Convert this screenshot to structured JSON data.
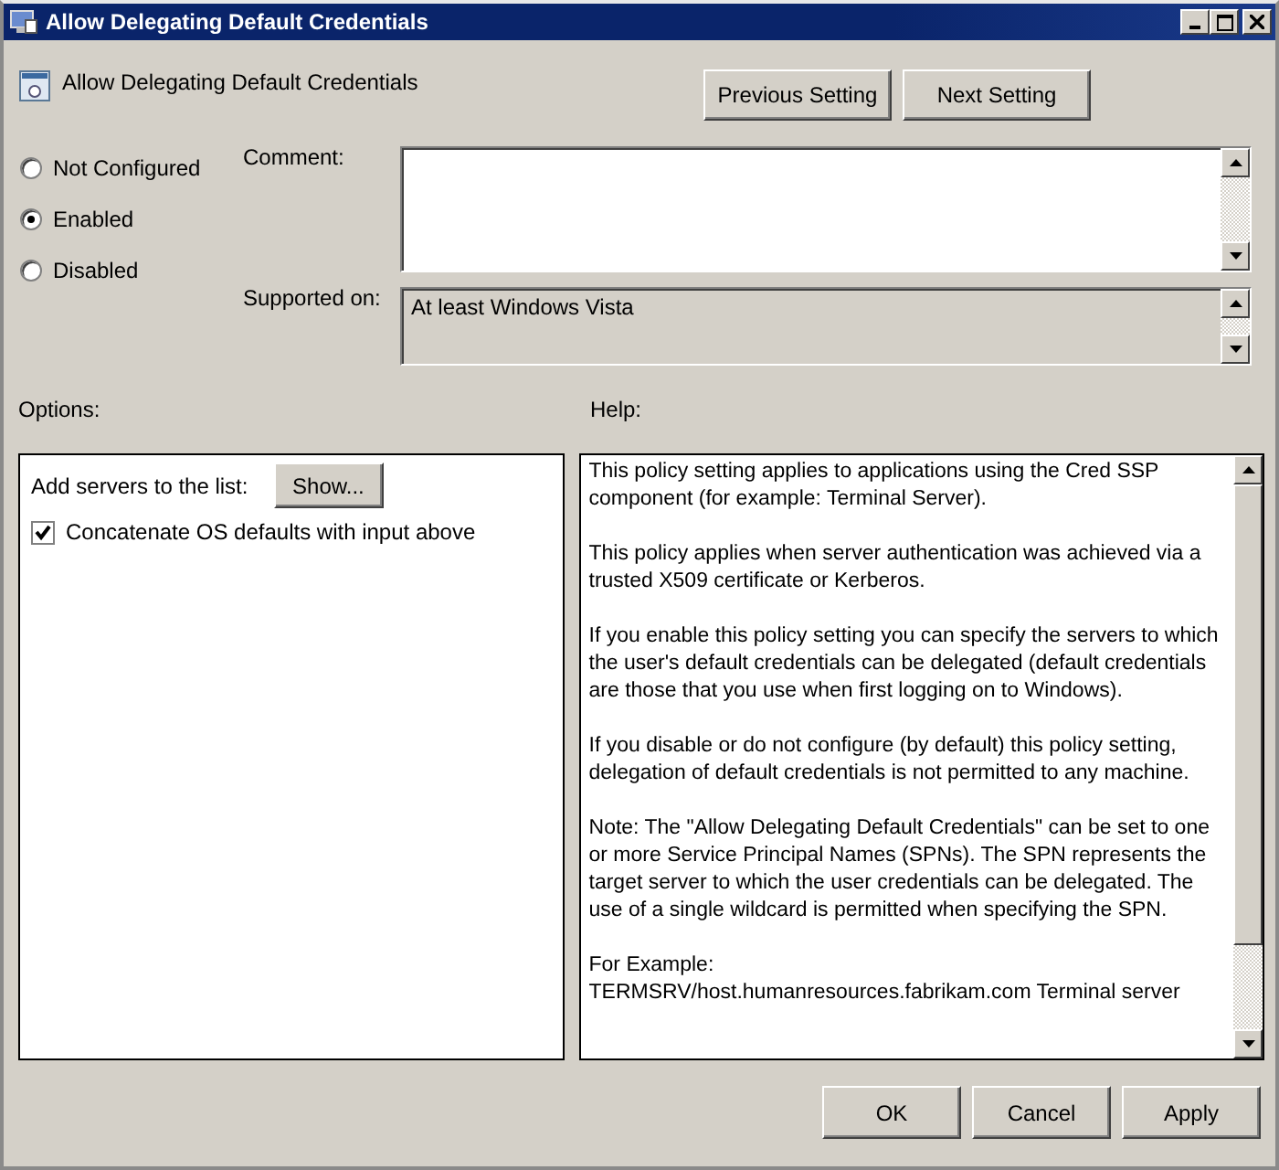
{
  "window": {
    "title": "Allow Delegating Default Credentials"
  },
  "header": {
    "title": "Allow Delegating Default Credentials"
  },
  "nav_buttons": [
    "Previous Setting",
    "Next Setting"
  ],
  "states": [
    {
      "label": "Not Configured",
      "selected": false
    },
    {
      "label": "Enabled",
      "selected": true
    },
    {
      "label": "Disabled",
      "selected": false
    }
  ],
  "comment": {
    "label": "Comment:"
  },
  "supported_on": {
    "label": "Supported on:",
    "value": "At least Windows Vista"
  },
  "options": {
    "label": "Options:",
    "items": [
      {
        "kind": "button",
        "label": "Add servers to the list:",
        "button": "Show..."
      },
      {
        "kind": "checkbox",
        "label": "Concatenate OS defaults with input above",
        "checked": true
      }
    ]
  },
  "help": {
    "label": "Help:",
    "paragraphs": [
      "This policy setting applies to applications using the Cred SSP component (for example: Terminal Server).",
      "This policy applies when server authentication was achieved via a trusted X509 certificate or Kerberos.",
      "If you enable this policy setting you can specify the servers to which the user's default credentials can be delegated (default credentials are those that you use when first logging on to Windows).",
      "If you disable or do not configure (by default) this policy setting, delegation of default credentials is not permitted to any machine.",
      "Note: The \"Allow Delegating Default Credentials\" can be set to one or more Service Principal Names (SPNs).  The SPN represents the target server to which the user credentials can be delegated.  The use of a single wildcard is permitted when specifying the SPN.",
      "For Example:\nTERMSRV/host.humanresources.fabrikam.com Terminal server"
    ]
  },
  "buttons": [
    "OK",
    "Cancel",
    "Apply"
  ]
}
